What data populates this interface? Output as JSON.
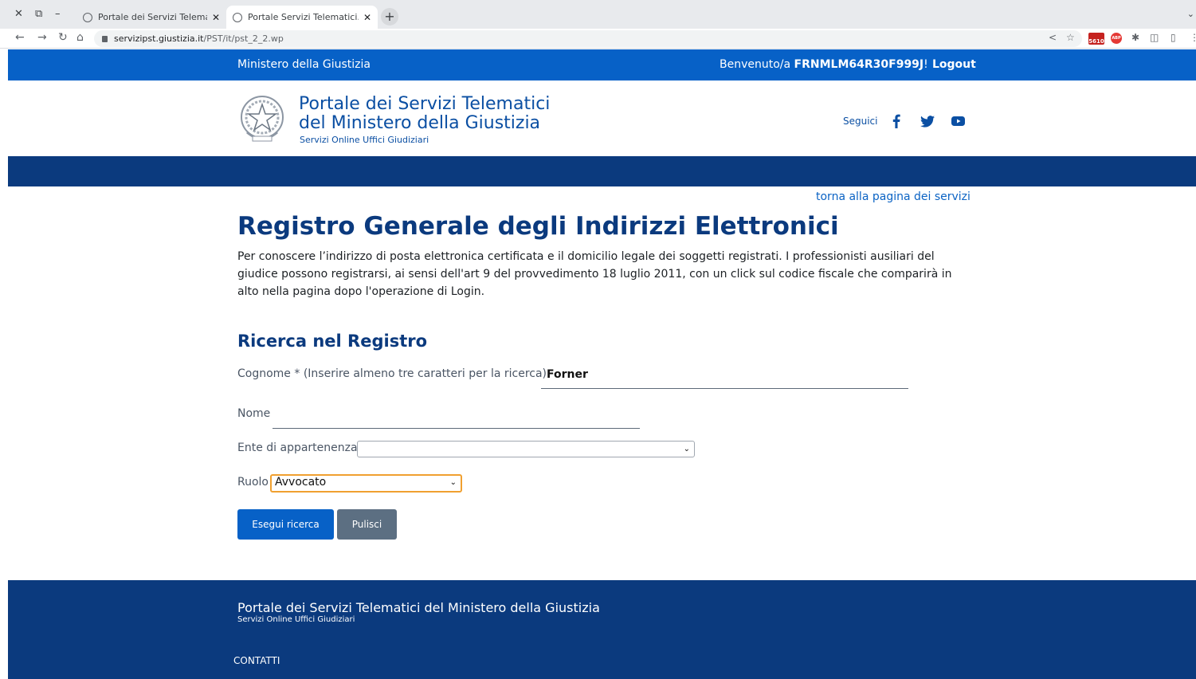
{
  "browser": {
    "tabs": [
      {
        "label": "Portale dei Servizi Telematici",
        "active": false
      },
      {
        "label": "Portale Servizi Telematici. Registro",
        "active": true
      }
    ],
    "url_host": "servizipst.giustizia.it",
    "url_path": "/PST/it/pst_2_2.wp",
    "mail_badge": "5610",
    "abp_badge": "ABP"
  },
  "topbar": {
    "ministry": "Ministero della Giustizia",
    "welcome_prefix": "Benvenuto/a",
    "user_code": "FRNMLM64R30F999J",
    "welcome_suffix": "!",
    "logout": "Logout"
  },
  "header": {
    "title_line1": "Portale dei Servizi Telematici",
    "title_line2": "del Ministero della Giustizia",
    "subtitle": "Servizi Online Uffici Giudiziari",
    "follow_label": "Seguici",
    "social_icons": [
      "facebook-icon",
      "twitter-icon",
      "youtube-icon"
    ]
  },
  "main": {
    "back_link": "torna alla pagina dei servizi",
    "title": "Registro Generale degli Indirizzi Elettronici",
    "intro": "Per conoscere l’indirizzo di posta elettronica certificata e il domicilio legale dei soggetti registrati. I professionisti ausiliari del giudice possono registrarsi, ai sensi dell'art 9 del provvedimento 18 luglio 2011, con un click sul codice fiscale che comparirà in alto nella pagina dopo l'operazione di Login.",
    "search_title": "Ricerca nel Registro"
  },
  "form": {
    "cognome_label": "Cognome * (Inserire almeno tre caratteri per la ricerca)",
    "cognome_value": "Forner",
    "nome_label": "Nome",
    "nome_value": "",
    "ente_label": "Ente di appartenenza",
    "ente_value": "",
    "ruolo_label": "Ruolo",
    "ruolo_value": "Avvocato",
    "search_button": "Esegui ricerca",
    "clear_button": "Pulisci"
  },
  "footer": {
    "title": "Portale dei Servizi Telematici del Ministero della Giustizia",
    "subtitle": "Servizi Online Uffici Giudiziari",
    "contacts": "CONTATTI"
  },
  "colors": {
    "brand_blue": "#0761c7",
    "dark_blue": "#0b3a7e",
    "focus_orange": "#f0a030",
    "secondary_gray": "#5c6f82"
  }
}
